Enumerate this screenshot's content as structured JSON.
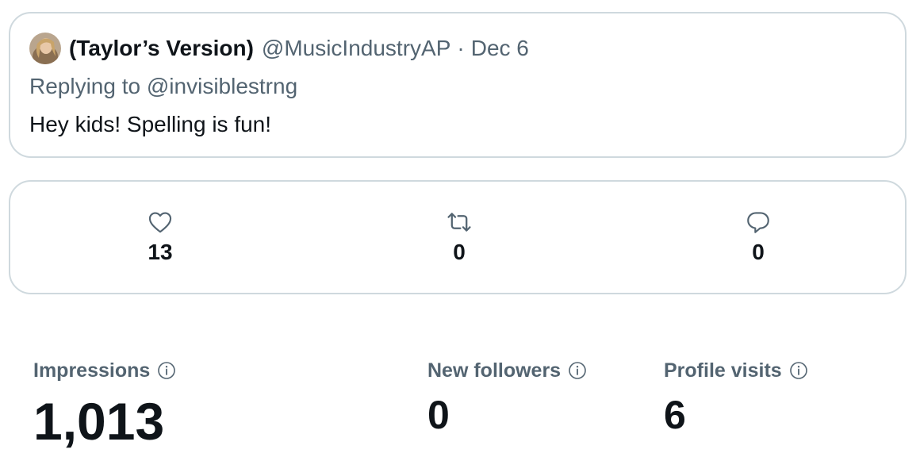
{
  "tweet": {
    "author_name": "(Taylor’s Version)",
    "author_handle": "@MusicIndustryAP",
    "separator": "·",
    "date": "Dec 6",
    "replying_prefix": "Replying to ",
    "replying_handle": "@invisiblestrng",
    "text": "Hey kids! Spelling is fun!"
  },
  "engagement": {
    "likes": {
      "icon": "heart-icon",
      "count": "13"
    },
    "retweets": {
      "icon": "retweet-icon",
      "count": "0"
    },
    "replies": {
      "icon": "reply-icon",
      "count": "0"
    }
  },
  "stats": {
    "impressions": {
      "label": "Impressions",
      "value": "1,013",
      "icon": "info-icon"
    },
    "new_followers": {
      "label": "New followers",
      "value": "0",
      "icon": "info-icon"
    },
    "profile_visits": {
      "label": "Profile visits",
      "value": "6",
      "icon": "info-icon"
    }
  },
  "colors": {
    "text_primary": "#0f1419",
    "text_secondary": "#536471",
    "border": "#cfd9de"
  }
}
